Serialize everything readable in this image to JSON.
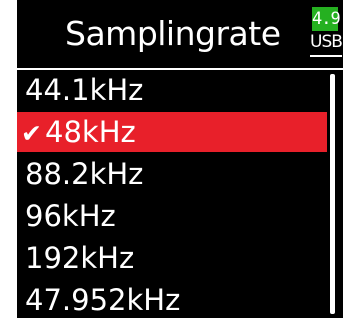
{
  "header": {
    "title": "Samplingrate",
    "battery": {
      "level": "4.9",
      "source": "USB",
      "color": "#25b020"
    }
  },
  "list": {
    "items": [
      {
        "label": "44.1kHz",
        "selected": false
      },
      {
        "label": "48kHz",
        "selected": true,
        "check_icon": "✔"
      },
      {
        "label": "88.2kHz",
        "selected": false
      },
      {
        "label": "96kHz",
        "selected": false
      },
      {
        "label": "192kHz",
        "selected": false
      },
      {
        "label": "47.952kHz",
        "selected": false
      }
    ],
    "selected_color": "#e8202a"
  }
}
